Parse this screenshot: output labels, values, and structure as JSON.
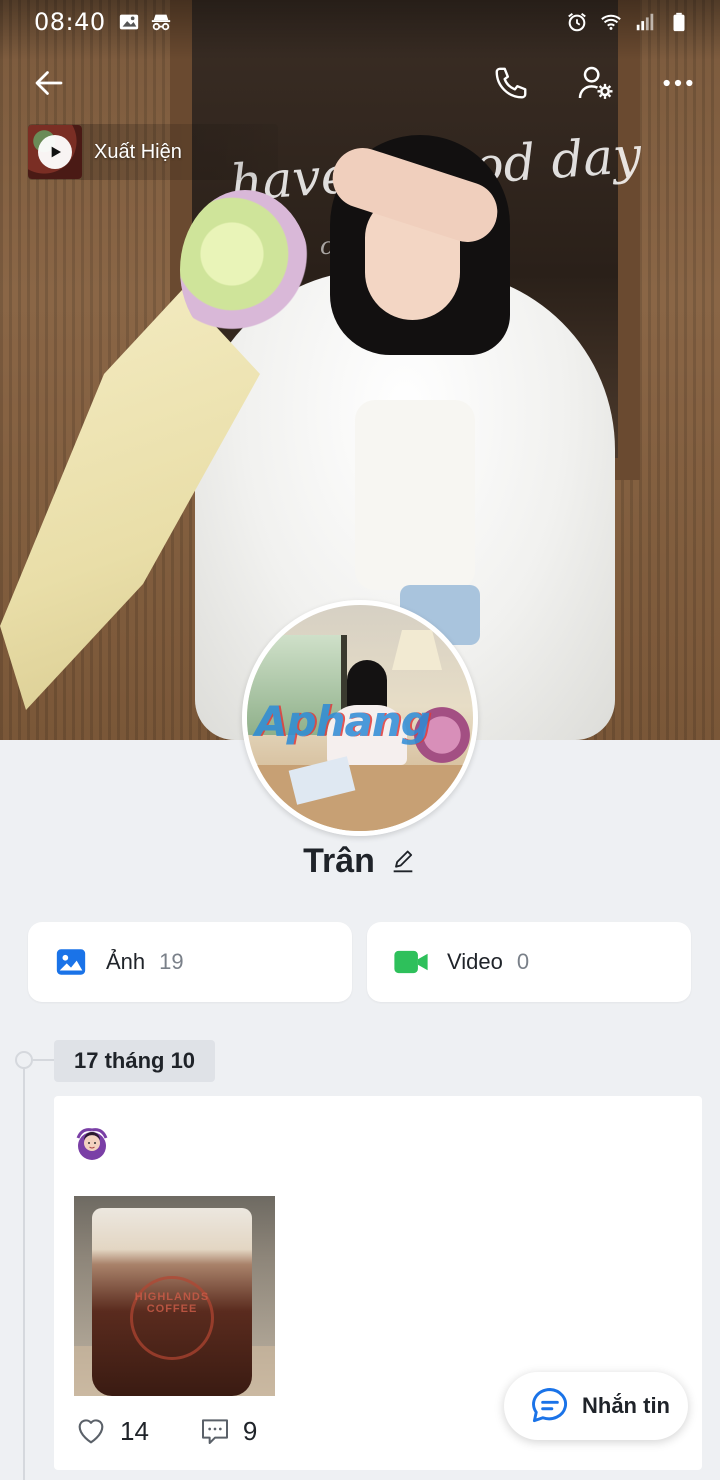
{
  "status_bar": {
    "time": "08:40",
    "icons_left": [
      "image-icon",
      "incognito-icon"
    ],
    "icons_right": [
      "alarm-icon",
      "wifi-icon",
      "signal-icon",
      "battery-icon"
    ]
  },
  "header": {
    "actions": [
      "back-arrow-icon",
      "phone-call-icon",
      "profile-settings-icon",
      "more-options-icon"
    ]
  },
  "music": {
    "title": "Xuất Hiện"
  },
  "cover": {
    "sign_text": "have a good day",
    "sign_sub": "coffee"
  },
  "avatar": {
    "watermark": "Aphang"
  },
  "profile": {
    "name": "Trân"
  },
  "media": {
    "photos": {
      "label": "Ảnh",
      "count": "19",
      "color": "#1a73e8"
    },
    "videos": {
      "label": "Video",
      "count": "0",
      "color": "#2ec05b"
    }
  },
  "timeline": {
    "date": "17 tháng 10"
  },
  "post": {
    "emoji": "🙆‍♀️",
    "photo_text": "HIGHLANDS COFFEE",
    "likes": "14",
    "comments": "9"
  },
  "message_button": {
    "label": "Nhắn tin",
    "accent": "#1a73e8"
  }
}
